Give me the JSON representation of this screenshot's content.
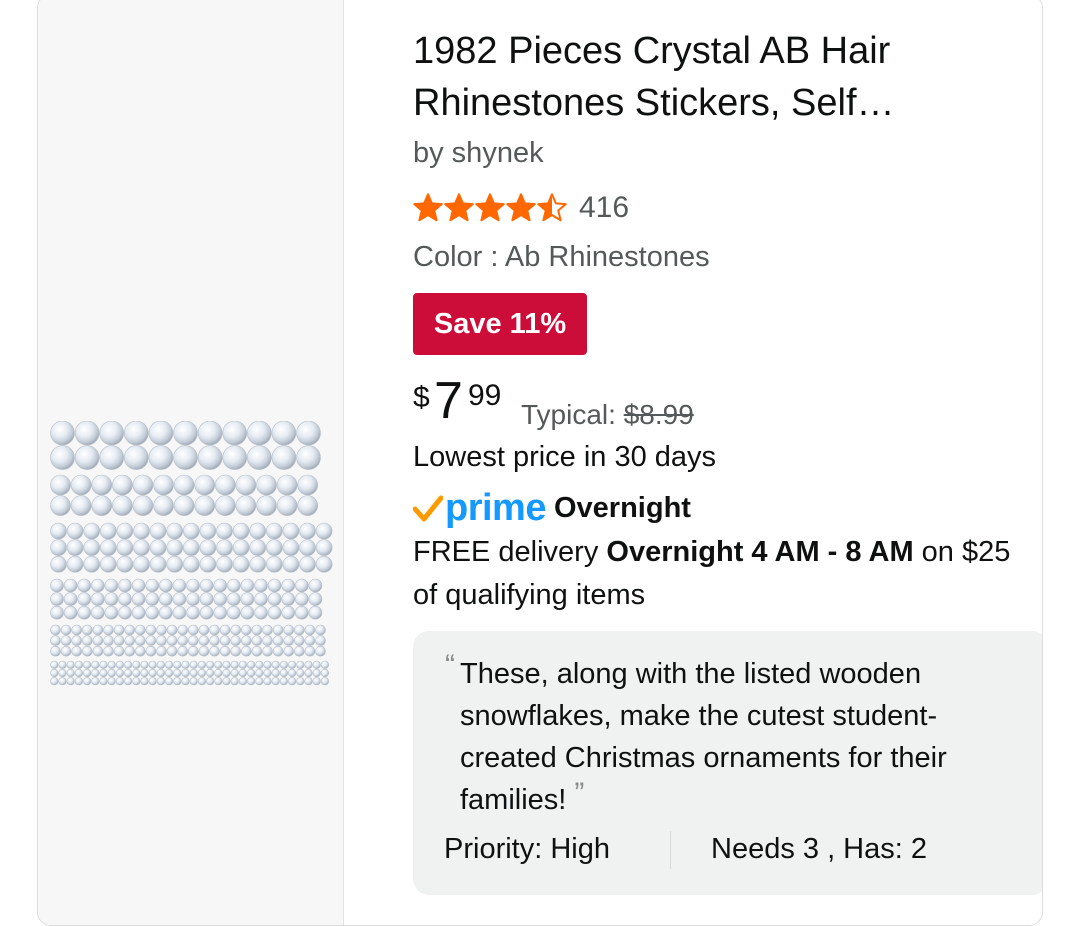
{
  "product": {
    "title": "1982 Pieces Crystal AB Hair Rhinestones Stickers, Self…",
    "byline": "by shynek",
    "image_alt": "Crystal AB rhinestone sticker sheet",
    "rating": {
      "stars": 4.5,
      "count": "416"
    },
    "color_line": "Color : Ab Rhinestones",
    "save_badge": "Save 11%",
    "price": {
      "symbol": "$",
      "whole": "7",
      "fraction": "99"
    },
    "typical": {
      "label": "Typical: ",
      "value": "$8.99"
    },
    "lowest_note": "Lowest price in 30 days",
    "prime": {
      "word": "prime",
      "label": "Overnight"
    },
    "delivery": {
      "prefix": "FREE delivery ",
      "window": "Overnight 4 AM - 8 AM",
      "suffix": " on $25 of qualifying items"
    }
  },
  "quote": {
    "open_mark": "“",
    "text": "These, along with the listed wooden snowflakes, make the cutest student-created Christmas ornaments for their families!",
    "close_mark": "”",
    "priority": "Priority: High",
    "needs": "Needs 3 , Has: 2"
  },
  "colors": {
    "save_badge": "#cc0c39",
    "star": "#ff6700",
    "prime_blue": "#1399ff",
    "prime_check": "#ff9900",
    "quote_bg": "#f0f2f2"
  }
}
